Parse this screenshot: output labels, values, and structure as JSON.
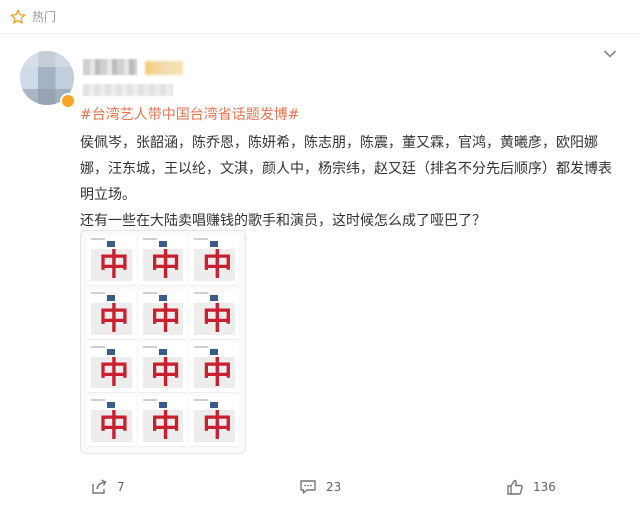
{
  "header": {
    "label": "热门",
    "icon": "star-icon"
  },
  "post": {
    "topic": "#台湾艺人带中国台湾省话题发博#",
    "paragraphs": [
      "侯佩岑，张韶涵，陈乔恩，陈妍希，陈志朋，陈震，董又霖，官鸿，黄曦彦，欧阳娜娜，汪东城，王以纶，文淇，颜人中，杨宗纬，赵又廷（排名不分先后顺序）都发博表明立场。",
      "还有一些在大陆卖唱赚钱的歌手和演员，这时候怎么成了哑巴了？"
    ],
    "image_text": "中",
    "menu_icon": "chevron-down-icon"
  },
  "actions": {
    "share": {
      "icon": "share-icon",
      "count": "7"
    },
    "comment": {
      "icon": "comment-icon",
      "count": "23"
    },
    "like": {
      "icon": "thumbs-up-icon",
      "count": "136"
    }
  },
  "colors": {
    "accent": "#eb7350",
    "badge": "#f5a623",
    "text": "#333333"
  }
}
